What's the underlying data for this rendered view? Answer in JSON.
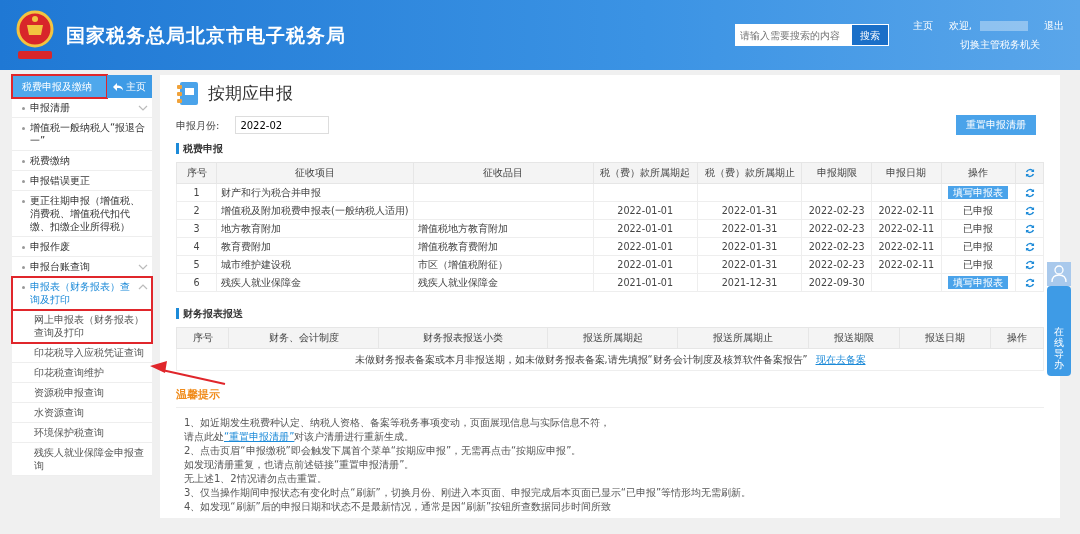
{
  "header": {
    "title": "国家税务总局北京市电子税务局",
    "search": {
      "placeholder": "请输入需要搜索的内容",
      "button": "搜索"
    },
    "links": [
      "主页",
      "欢迎,",
      "退出"
    ],
    "switch_link": "切换主管税务机关"
  },
  "sidebar": {
    "tab": {
      "label": "税费申报及缴纳",
      "highlighted": true
    },
    "home_button": "主页",
    "items": [
      {
        "label": "申报清册",
        "expanded": false,
        "selected": false,
        "highlighted": false
      },
      {
        "label": "增值税一般纳税人“报退合一”",
        "selected": false,
        "highlighted": false
      },
      {
        "label": "税费缴纳",
        "selected": false,
        "highlighted": false
      },
      {
        "label": "申报错误更正",
        "selected": false,
        "highlighted": false
      },
      {
        "label": "更正往期申报（增值税、消费税、增值税代扣代缴、扣缴企业所得税）",
        "selected": false,
        "highlighted": false
      },
      {
        "label": "申报作废",
        "selected": false,
        "highlighted": false
      },
      {
        "label": "申报台账查询",
        "expanded": false,
        "selected": false,
        "highlighted": false
      },
      {
        "label": "申报表（财务报表）查询及打印",
        "expanded": true,
        "selected": true,
        "highlighted": true,
        "children": [
          {
            "label": "网上申报表（财务报表）查询及打印",
            "highlighted": true
          },
          {
            "label": "印花税导入应税凭证查询",
            "highlighted": false
          },
          {
            "label": "印花税查询维护",
            "highlighted": false
          },
          {
            "label": "资源税申报查询",
            "highlighted": false
          },
          {
            "label": "水资源查询",
            "highlighted": false
          },
          {
            "label": "环境保护税查询",
            "highlighted": false
          },
          {
            "label": "残疾人就业保障金申报查询",
            "highlighted": false
          }
        ]
      }
    ]
  },
  "page": {
    "title": "按期应申报",
    "month_label": "申报月份:",
    "month_value": "2022-02",
    "reset_button": "重置申报清册"
  },
  "tax_section": {
    "title": "税费申报",
    "columns": [
      "序号",
      "征收项目",
      "征收品目",
      "税（费）款所属期起",
      "税（费）款所属期止",
      "申报期限",
      "申报日期",
      "操作"
    ],
    "rows": [
      {
        "no": "1",
        "item": "财产和行为税合并申报",
        "category": "",
        "start": "",
        "end": "",
        "deadline": "",
        "date": "",
        "action": {
          "kind": "button",
          "label": "填写申报表"
        }
      },
      {
        "no": "2",
        "item": "增值税及附加税费申报表(一般纳税人适用)",
        "category": "",
        "start": "2022-01-01",
        "end": "2022-01-31",
        "deadline": "2022-02-23",
        "date": "2022-02-11",
        "action": {
          "kind": "status",
          "label": "已申报"
        }
      },
      {
        "no": "3",
        "item": "地方教育附加",
        "category": "增值税地方教育附加",
        "start": "2022-01-01",
        "end": "2022-01-31",
        "deadline": "2022-02-23",
        "date": "2022-02-11",
        "action": {
          "kind": "status",
          "label": "已申报"
        }
      },
      {
        "no": "4",
        "item": "教育费附加",
        "category": "增值税教育费附加",
        "start": "2022-01-01",
        "end": "2022-01-31",
        "deadline": "2022-02-23",
        "date": "2022-02-11",
        "action": {
          "kind": "status",
          "label": "已申报"
        }
      },
      {
        "no": "5",
        "item": "城市维护建设税",
        "category": "市区（增值税附征）",
        "start": "2022-01-01",
        "end": "2022-01-31",
        "deadline": "2022-02-23",
        "date": "2022-02-11",
        "action": {
          "kind": "status",
          "label": "已申报"
        }
      },
      {
        "no": "6",
        "item": "残疾人就业保障金",
        "category": "残疾人就业保障金",
        "start": "2021-01-01",
        "end": "2021-12-31",
        "deadline": "2022-09-30",
        "date": "",
        "action": {
          "kind": "button",
          "label": "填写申报表"
        }
      }
    ]
  },
  "report_section": {
    "title": "财务报表报送",
    "columns": [
      "序号",
      "财务、会计制度",
      "财务报表报送小类",
      "报送所属期起",
      "报送所属期止",
      "报送期限",
      "报送日期",
      "操作"
    ],
    "empty_message": "未做财务报表备案或本月非报送期，如未做财务报表备案,请先填报“财务会计制度及核算软件备案报告”",
    "empty_link": "现在去备案"
  },
  "tips": {
    "title": "温馨提示",
    "lines": [
      {
        "text": "1、如近期发生税费种认定、纳税人资格、备案等税务事项变动，页面展现信息与实际信息不符，"
      },
      {
        "text": "请点此处",
        "link": "“重置申报清册”",
        "after": "对该户清册进行重新生成。"
      },
      {
        "text": "2、点击页眉“申报缴税”即会触发下属首个菜单“按期应申报”，无需再点击“按期应申报”。"
      },
      {
        "text": "如发现清册重复，也请点前述链接“重置申报清册”。"
      },
      {
        "text": "无上述1、2情况请勿点击重置。"
      },
      {
        "text": "3、仅当操作期间申报状态有变化时点“刷新”，切换月份、刚进入本页面、申报完成后本页面已显示“已申报”等情形均无需刷新。"
      },
      {
        "text": "4、如发现“刷新”后的申报日期和状态不是最新情况，通常是因“刷新”按钮所查数据同步时间所致"
      }
    ]
  },
  "float_widget": {
    "label": "在线导办"
  },
  "annotation": {
    "kind": "arrow"
  }
}
